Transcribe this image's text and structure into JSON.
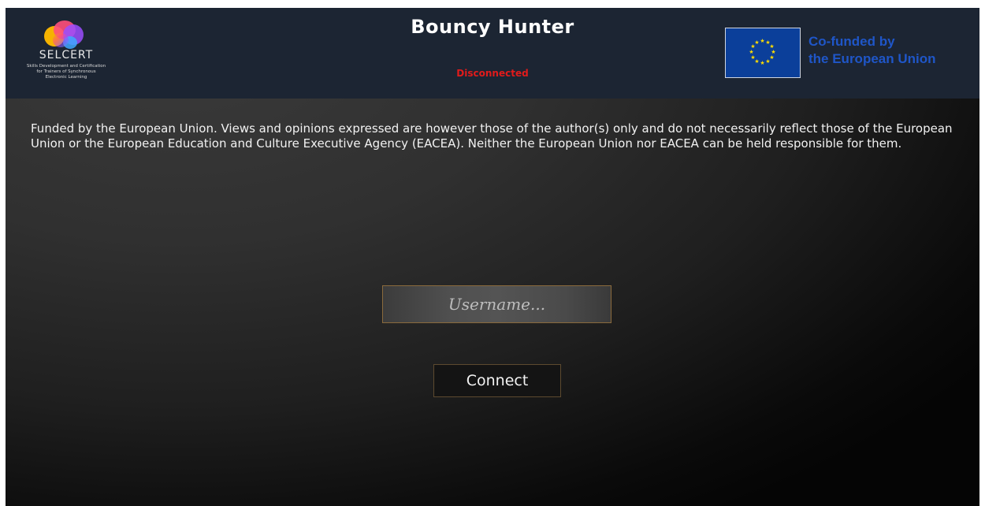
{
  "header": {
    "logo": {
      "name": "SELCERT",
      "tagline": "Skills Development and Certification\nfor Trainers of Synchronous\nElectronic Learning"
    },
    "title": "Bouncy Hunter",
    "status": "Disconnected",
    "status_color": "#e11b1b",
    "eu_badge": {
      "line1": "Co-funded by",
      "line2": "the European Union"
    }
  },
  "disclaimer": "Funded by the European Union. Views and opinions expressed are however those of the author(s) only and do not necessarily reflect those of the European Union or the European Education and Culture Executive Agency (EACEA). Neither the European Union nor EACEA can be held responsible for them.",
  "login": {
    "username_placeholder": "Username...",
    "username_value": "",
    "connect_label": "Connect"
  },
  "colors": {
    "header_bg": "#1c2533",
    "eu_blue": "#1f56c8",
    "flag_blue": "#0b3f9a",
    "flag_star": "#ffdd00"
  },
  "icons": {
    "logo": "brain-logo-icon",
    "flag": "eu-flag-icon"
  }
}
